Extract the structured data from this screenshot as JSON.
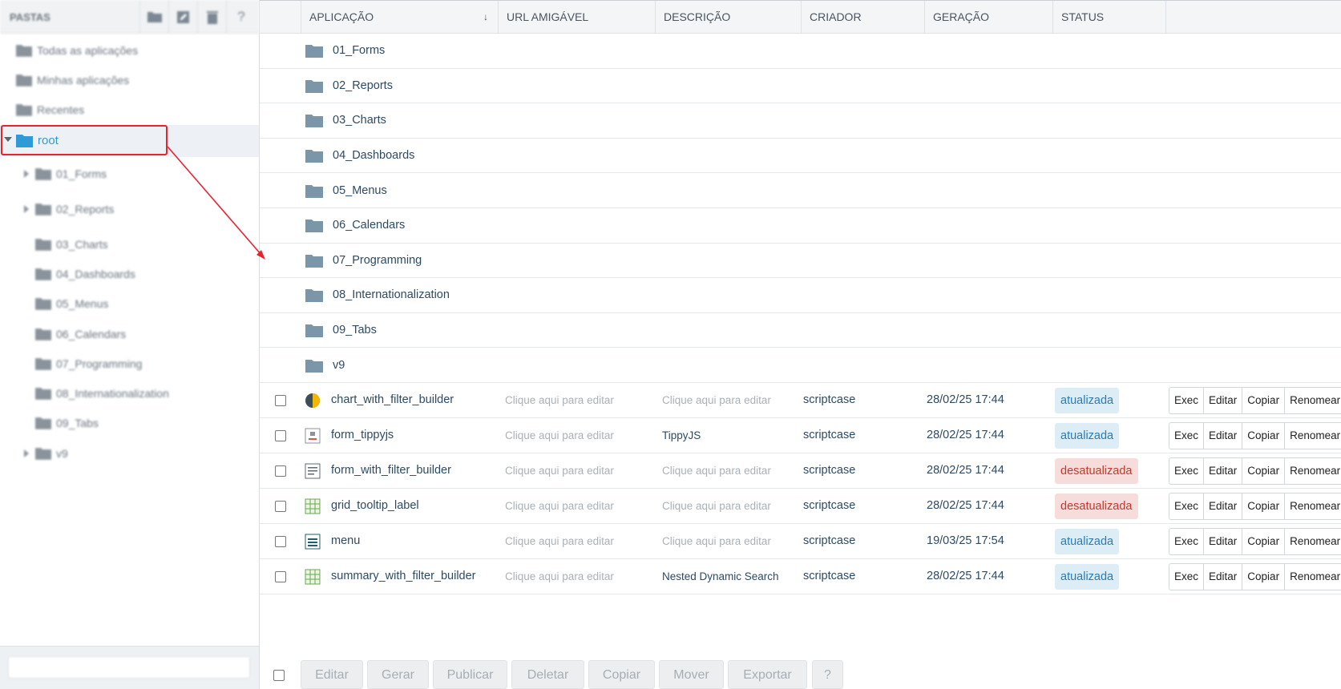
{
  "sidebar": {
    "title": "PASTAS",
    "toolbar_icons": [
      "new-folder-icon",
      "edit-folder-icon",
      "delete-folder-icon",
      "help-icon"
    ],
    "help_glyph": "?",
    "top_items": [
      {
        "label": "Todas as aplicações"
      },
      {
        "label": "Minhas aplicações"
      },
      {
        "label": "Recentes"
      }
    ],
    "root_label": "root",
    "children": [
      {
        "label": "01_Forms",
        "expandable": true
      },
      {
        "label": "02_Reports",
        "expandable": true
      },
      {
        "label": "03_Charts",
        "expandable": false
      },
      {
        "label": "04_Dashboards",
        "expandable": false
      },
      {
        "label": "05_Menus",
        "expandable": false
      },
      {
        "label": "06_Calendars",
        "expandable": false
      },
      {
        "label": "07_Programming",
        "expandable": false
      },
      {
        "label": "08_Internationalization",
        "expandable": false
      },
      {
        "label": "09_Tabs",
        "expandable": false
      },
      {
        "label": "v9",
        "expandable": true
      }
    ],
    "search_placeholder": ""
  },
  "table": {
    "headers": {
      "app": "APLICAÇÃO",
      "sort_glyph": "↓",
      "url": "URL AMIGÁVEL",
      "desc": "DESCRIÇÃO",
      "creator": "CRIADOR",
      "gen": "GERAÇÃO",
      "status": "STATUS"
    },
    "folders": [
      {
        "name": "01_Forms"
      },
      {
        "name": "02_Reports"
      },
      {
        "name": "03_Charts"
      },
      {
        "name": "04_Dashboards"
      },
      {
        "name": "05_Menus"
      },
      {
        "name": "06_Calendars"
      },
      {
        "name": "07_Programming"
      },
      {
        "name": "08_Internationalization"
      },
      {
        "name": "09_Tabs"
      },
      {
        "name": "v9"
      }
    ],
    "apps": [
      {
        "name": "chart_with_filter_builder",
        "icon": "chart-app-icon",
        "url": "Clique aqui para editar",
        "desc": "Clique aqui para editar",
        "desc_set": false,
        "creator": "scriptcase",
        "gen": "28/02/25 17:44",
        "status": "atualizada",
        "status_kind": "ok"
      },
      {
        "name": "form_tippyjs",
        "icon": "form-app-icon",
        "url": "Clique aqui para editar",
        "desc": "TippyJS",
        "desc_set": true,
        "creator": "scriptcase",
        "gen": "28/02/25 17:44",
        "status": "atualizada",
        "status_kind": "ok"
      },
      {
        "name": "form_with_filter_builder",
        "icon": "filter-app-icon",
        "url": "Clique aqui para editar",
        "desc": "Clique aqui para editar",
        "desc_set": false,
        "creator": "scriptcase",
        "gen": "28/02/25 17:44",
        "status": "desatualizada",
        "status_kind": "bad"
      },
      {
        "name": "grid_tooltip_label",
        "icon": "grid-app-icon",
        "url": "Clique aqui para editar",
        "desc": "Clique aqui para editar",
        "desc_set": false,
        "creator": "scriptcase",
        "gen": "28/02/25 17:44",
        "status": "desatualizada",
        "status_kind": "bad"
      },
      {
        "name": "menu",
        "icon": "menu-app-icon",
        "url": "Clique aqui para editar",
        "desc": "Clique aqui para editar",
        "desc_set": false,
        "creator": "scriptcase",
        "gen": "19/03/25 17:54",
        "status": "atualizada",
        "status_kind": "ok"
      },
      {
        "name": "summary_with_filter_builder",
        "icon": "summary-app-icon",
        "url": "Clique aqui para editar",
        "desc": "Nested Dynamic Search",
        "desc_set": true,
        "creator": "scriptcase",
        "gen": "28/02/25 17:44",
        "status": "atualizada",
        "status_kind": "ok"
      }
    ],
    "row_actions": [
      "Exec",
      "Editar",
      "Copiar",
      "Renomear"
    ]
  },
  "bottom_toolbar": [
    "Editar",
    "Gerar",
    "Publicar",
    "Deletar",
    "Copiar",
    "Mover",
    "Exportar",
    "?"
  ],
  "colors": {
    "accent": "#2f9bd6",
    "highlight_box": "#e8232f",
    "status_ok_bg": "#dcedf6",
    "status_bad_bg": "#f7dcdc",
    "folder": "#7a96a8"
  }
}
